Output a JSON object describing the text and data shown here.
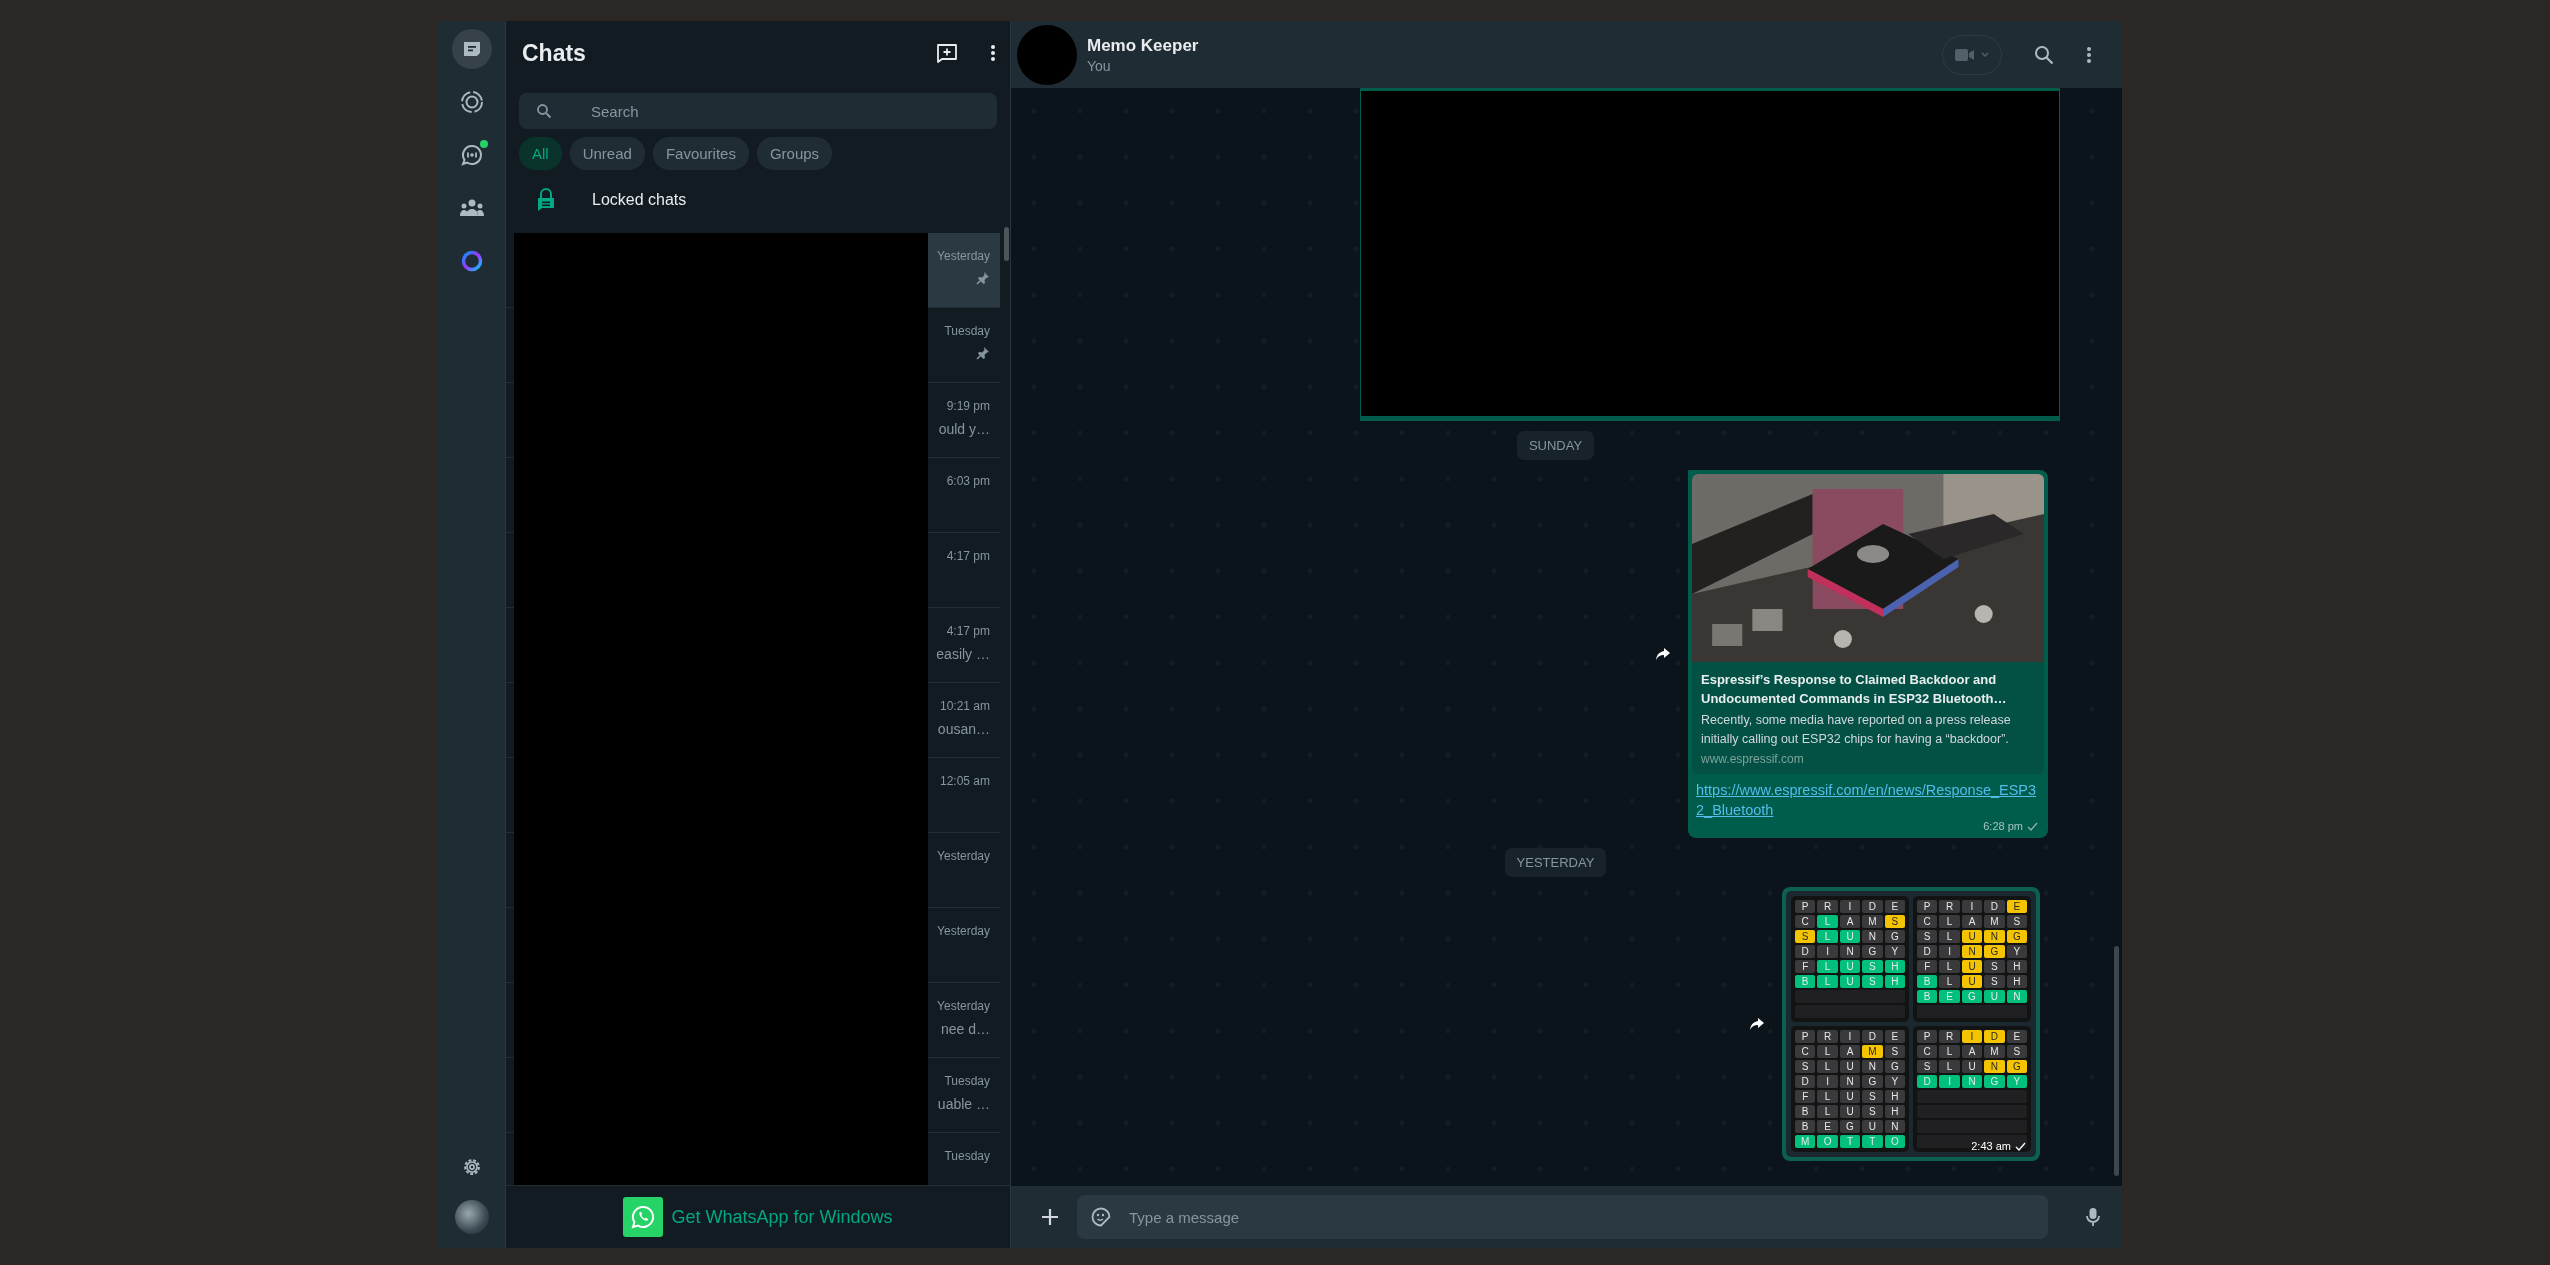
{
  "nav": {
    "top": [
      {
        "kind": "chats",
        "selected": true,
        "badge": false
      },
      {
        "kind": "status",
        "selected": false,
        "badge": false
      },
      {
        "kind": "channels",
        "selected": false,
        "badge": true
      },
      {
        "kind": "communities",
        "selected": false,
        "badge": false
      },
      {
        "kind": "meta_ai",
        "selected": false,
        "badge": false
      }
    ],
    "bottom": [
      {
        "kind": "settings"
      },
      {
        "kind": "profile"
      }
    ]
  },
  "chat_list": {
    "title": "Chats",
    "search": {
      "placeholder": "Search"
    },
    "filters": [
      {
        "label": "All",
        "selected": true
      },
      {
        "label": "Unread",
        "selected": false
      },
      {
        "label": "Favourites",
        "selected": false
      },
      {
        "label": "Groups",
        "selected": false
      }
    ],
    "locked": {
      "label": "Locked chats"
    },
    "rows": [
      {
        "time": "Yesterday",
        "pinned": true,
        "selected": true
      },
      {
        "time": "Tuesday",
        "pinned": true,
        "selected": false
      },
      {
        "time": "9:19 pm",
        "preview": "ould y…",
        "pinned": false,
        "selected": false
      },
      {
        "time": "6:03 pm",
        "pinned": false,
        "selected": false
      },
      {
        "time": "4:17 pm",
        "pinned": false,
        "selected": false
      },
      {
        "time": "4:17 pm",
        "preview": "easily …",
        "pinned": false,
        "selected": false
      },
      {
        "time": "10:21 am",
        "preview": "ousan…",
        "pinned": false,
        "selected": false
      },
      {
        "time": "12:05 am",
        "pinned": false,
        "selected": false
      },
      {
        "time": "Yesterday",
        "pinned": false,
        "selected": false
      },
      {
        "time": "Yesterday",
        "pinned": false,
        "selected": false
      },
      {
        "time": "Yesterday",
        "preview": "nee d…",
        "pinned": false,
        "selected": false
      },
      {
        "time": "Tuesday",
        "preview": "uable …",
        "pinned": false,
        "selected": false
      },
      {
        "time": "Tuesday",
        "pinned": false,
        "selected": false
      }
    ],
    "promo": {
      "label": "Get WhatsApp for Windows"
    }
  },
  "conversation": {
    "name": "Memo Keeper",
    "subtitle": "You",
    "messages": [
      {
        "kind": "redacted_media"
      },
      {
        "kind": "date",
        "label": "SUNDAY"
      },
      {
        "kind": "link",
        "forward": true,
        "title": "Espressif’s Response to Claimed Backdoor and Undocumented Commands in ESP32 Bluetooth…",
        "description": "Recently, some media have reported on a press release initially calling out ESP32 chips for having a “backdoor”.",
        "domain": "www.espressif.com",
        "url": "https://www.espressif.com/en/news/Response_ESP32_Bluetooth",
        "time": "6:28 pm",
        "sent": true
      },
      {
        "kind": "date",
        "label": "YESTERDAY"
      },
      {
        "kind": "wordle",
        "forward": true,
        "time": "2:43 am",
        "sent": true,
        "boards": [
          {
            "rows": [
              {
                "kind": "guess",
                "cells": [
                  {
                    "letter": "P",
                    "color": "#3a3a3c"
                  },
                  {
                    "letter": "R",
                    "color": "#3a3a3c"
                  },
                  {
                    "letter": "I",
                    "color": "#3a3a3c"
                  },
                  {
                    "letter": "D",
                    "color": "#3a3a3c"
                  },
                  {
                    "letter": "E",
                    "color": "#3a3a3c"
                  }
                ]
              },
              {
                "kind": "guess",
                "cells": [
                  {
                    "letter": "C",
                    "color": "#3a3a3c"
                  },
                  {
                    "letter": "L",
                    "color": "#00c07c"
                  },
                  {
                    "letter": "A",
                    "color": "#3a3a3c"
                  },
                  {
                    "letter": "M",
                    "color": "#3a3a3c"
                  },
                  {
                    "letter": "S",
                    "color": "#f5c400"
                  }
                ]
              },
              {
                "kind": "guess",
                "cells": [
                  {
                    "letter": "S",
                    "color": "#f5c400"
                  },
                  {
                    "letter": "L",
                    "color": "#00c07c"
                  },
                  {
                    "letter": "U",
                    "color": "#00c07c"
                  },
                  {
                    "letter": "N",
                    "color": "#3a3a3c"
                  },
                  {
                    "letter": "G",
                    "color": "#3a3a3c"
                  }
                ]
              },
              {
                "kind": "guess",
                "cells": [
                  {
                    "letter": "D",
                    "color": "#3a3a3c"
                  },
                  {
                    "letter": "I",
                    "color": "#3a3a3c"
                  },
                  {
                    "letter": "N",
                    "color": "#3a3a3c"
                  },
                  {
                    "letter": "G",
                    "color": "#3a3a3c"
                  },
                  {
                    "letter": "Y",
                    "color": "#3a3a3c"
                  }
                ]
              },
              {
                "kind": "guess",
                "cells": [
                  {
                    "letter": "F",
                    "color": "#3a3a3c"
                  },
                  {
                    "letter": "L",
                    "color": "#00c07c"
                  },
                  {
                    "letter": "U",
                    "color": "#00c07c"
                  },
                  {
                    "letter": "S",
                    "color": "#00c07c"
                  },
                  {
                    "letter": "H",
                    "color": "#00c07c"
                  }
                ]
              },
              {
                "kind": "guess",
                "cells": [
                  {
                    "letter": "B",
                    "color": "#00c07c"
                  },
                  {
                    "letter": "L",
                    "color": "#00c07c"
                  },
                  {
                    "letter": "U",
                    "color": "#00c07c"
                  },
                  {
                    "letter": "S",
                    "color": "#00c07c"
                  },
                  {
                    "letter": "H",
                    "color": "#00c07c"
                  }
                ]
              },
              {
                "kind": "blank"
              },
              {
                "kind": "blank"
              }
            ]
          },
          {
            "rows": [
              {
                "kind": "guess",
                "cells": [
                  {
                    "letter": "P",
                    "color": "#3a3a3c"
                  },
                  {
                    "letter": "R",
                    "color": "#3a3a3c"
                  },
                  {
                    "letter": "I",
                    "color": "#3a3a3c"
                  },
                  {
                    "letter": "D",
                    "color": "#3a3a3c"
                  },
                  {
                    "letter": "E",
                    "color": "#f5c400"
                  }
                ]
              },
              {
                "kind": "guess",
                "cells": [
                  {
                    "letter": "C",
                    "color": "#3a3a3c"
                  },
                  {
                    "letter": "L",
                    "color": "#3a3a3c"
                  },
                  {
                    "letter": "A",
                    "color": "#3a3a3c"
                  },
                  {
                    "letter": "M",
                    "color": "#3a3a3c"
                  },
                  {
                    "letter": "S",
                    "color": "#3a3a3c"
                  }
                ]
              },
              {
                "kind": "guess",
                "cells": [
                  {
                    "letter": "S",
                    "color": "#3a3a3c"
                  },
                  {
                    "letter": "L",
                    "color": "#3a3a3c"
                  },
                  {
                    "letter": "U",
                    "color": "#f5c400"
                  },
                  {
                    "letter": "N",
                    "color": "#f5c400"
                  },
                  {
                    "letter": "G",
                    "color": "#f5c400"
                  }
                ]
              },
              {
                "kind": "guess",
                "cells": [
                  {
                    "letter": "D",
                    "color": "#3a3a3c"
                  },
                  {
                    "letter": "I",
                    "color": "#3a3a3c"
                  },
                  {
                    "letter": "N",
                    "color": "#f5c400"
                  },
                  {
                    "letter": "G",
                    "color": "#f5c400"
                  },
                  {
                    "letter": "Y",
                    "color": "#3a3a3c"
                  }
                ]
              },
              {
                "kind": "guess",
                "cells": [
                  {
                    "letter": "F",
                    "color": "#3a3a3c"
                  },
                  {
                    "letter": "L",
                    "color": "#3a3a3c"
                  },
                  {
                    "letter": "U",
                    "color": "#f5c400"
                  },
                  {
                    "letter": "S",
                    "color": "#3a3a3c"
                  },
                  {
                    "letter": "H",
                    "color": "#3a3a3c"
                  }
                ]
              },
              {
                "kind": "guess",
                "cells": [
                  {
                    "letter": "B",
                    "color": "#00c07c"
                  },
                  {
                    "letter": "L",
                    "color": "#3a3a3c"
                  },
                  {
                    "letter": "U",
                    "color": "#f5c400"
                  },
                  {
                    "letter": "S",
                    "color": "#3a3a3c"
                  },
                  {
                    "letter": "H",
                    "color": "#3a3a3c"
                  }
                ]
              },
              {
                "kind": "guess",
                "cells": [
                  {
                    "letter": "B",
                    "color": "#00c07c"
                  },
                  {
                    "letter": "E",
                    "color": "#00c07c"
                  },
                  {
                    "letter": "G",
                    "color": "#00c07c"
                  },
                  {
                    "letter": "U",
                    "color": "#00c07c"
                  },
                  {
                    "letter": "N",
                    "color": "#00c07c"
                  }
                ]
              },
              {
                "kind": "blank"
              }
            ]
          },
          {
            "rows": [
              {
                "kind": "guess",
                "cells": [
                  {
                    "letter": "P",
                    "color": "#3a3a3c"
                  },
                  {
                    "letter": "R",
                    "color": "#3a3a3c"
                  },
                  {
                    "letter": "I",
                    "color": "#3a3a3c"
                  },
                  {
                    "letter": "D",
                    "color": "#3a3a3c"
                  },
                  {
                    "letter": "E",
                    "color": "#3a3a3c"
                  }
                ]
              },
              {
                "kind": "guess",
                "cells": [
                  {
                    "letter": "C",
                    "color": "#3a3a3c"
                  },
                  {
                    "letter": "L",
                    "color": "#3a3a3c"
                  },
                  {
                    "letter": "A",
                    "color": "#3a3a3c"
                  },
                  {
                    "letter": "M",
                    "color": "#f5c400"
                  },
                  {
                    "letter": "S",
                    "color": "#3a3a3c"
                  }
                ]
              },
              {
                "kind": "guess",
                "cells": [
                  {
                    "letter": "S",
                    "color": "#3a3a3c"
                  },
                  {
                    "letter": "L",
                    "color": "#3a3a3c"
                  },
                  {
                    "letter": "U",
                    "color": "#3a3a3c"
                  },
                  {
                    "letter": "N",
                    "color": "#3a3a3c"
                  },
                  {
                    "letter": "G",
                    "color": "#3a3a3c"
                  }
                ]
              },
              {
                "kind": "guess",
                "cells": [
                  {
                    "letter": "D",
                    "color": "#3a3a3c"
                  },
                  {
                    "letter": "I",
                    "color": "#3a3a3c"
                  },
                  {
                    "letter": "N",
                    "color": "#3a3a3c"
                  },
                  {
                    "letter": "G",
                    "color": "#3a3a3c"
                  },
                  {
                    "letter": "Y",
                    "color": "#3a3a3c"
                  }
                ]
              },
              {
                "kind": "guess",
                "cells": [
                  {
                    "letter": "F",
                    "color": "#3a3a3c"
                  },
                  {
                    "letter": "L",
                    "color": "#3a3a3c"
                  },
                  {
                    "letter": "U",
                    "color": "#3a3a3c"
                  },
                  {
                    "letter": "S",
                    "color": "#3a3a3c"
                  },
                  {
                    "letter": "H",
                    "color": "#3a3a3c"
                  }
                ]
              },
              {
                "kind": "guess",
                "cells": [
                  {
                    "letter": "B",
                    "color": "#3a3a3c"
                  },
                  {
                    "letter": "L",
                    "color": "#3a3a3c"
                  },
                  {
                    "letter": "U",
                    "color": "#3a3a3c"
                  },
                  {
                    "letter": "S",
                    "color": "#3a3a3c"
                  },
                  {
                    "letter": "H",
                    "color": "#3a3a3c"
                  }
                ]
              },
              {
                "kind": "guess",
                "cells": [
                  {
                    "letter": "B",
                    "color": "#3a3a3c"
                  },
                  {
                    "letter": "E",
                    "color": "#3a3a3c"
                  },
                  {
                    "letter": "G",
                    "color": "#3a3a3c"
                  },
                  {
                    "letter": "U",
                    "color": "#3a3a3c"
                  },
                  {
                    "letter": "N",
                    "color": "#3a3a3c"
                  }
                ]
              },
              {
                "kind": "guess",
                "cells": [
                  {
                    "letter": "M",
                    "color": "#00c07c"
                  },
                  {
                    "letter": "O",
                    "color": "#00c07c"
                  },
                  {
                    "letter": "T",
                    "color": "#00c07c"
                  },
                  {
                    "letter": "T",
                    "color": "#00c07c"
                  },
                  {
                    "letter": "O",
                    "color": "#00c07c"
                  }
                ]
              }
            ]
          },
          {
            "rows": [
              {
                "kind": "guess",
                "cells": [
                  {
                    "letter": "P",
                    "color": "#3a3a3c"
                  },
                  {
                    "letter": "R",
                    "color": "#3a3a3c"
                  },
                  {
                    "letter": "I",
                    "color": "#f5c400"
                  },
                  {
                    "letter": "D",
                    "color": "#f5c400"
                  },
                  {
                    "letter": "E",
                    "color": "#3a3a3c"
                  }
                ]
              },
              {
                "kind": "guess",
                "cells": [
                  {
                    "letter": "C",
                    "color": "#3a3a3c"
                  },
                  {
                    "letter": "L",
                    "color": "#3a3a3c"
                  },
                  {
                    "letter": "A",
                    "color": "#3a3a3c"
                  },
                  {
                    "letter": "M",
                    "color": "#3a3a3c"
                  },
                  {
                    "letter": "S",
                    "color": "#3a3a3c"
                  }
                ]
              },
              {
                "kind": "guess",
                "cells": [
                  {
                    "letter": "S",
                    "color": "#3a3a3c"
                  },
                  {
                    "letter": "L",
                    "color": "#3a3a3c"
                  },
                  {
                    "letter": "U",
                    "color": "#3a3a3c"
                  },
                  {
                    "letter": "N",
                    "color": "#f5c400"
                  },
                  {
                    "letter": "G",
                    "color": "#f5c400"
                  }
                ]
              },
              {
                "kind": "guess",
                "cells": [
                  {
                    "letter": "D",
                    "color": "#00c07c"
                  },
                  {
                    "letter": "I",
                    "color": "#00c07c"
                  },
                  {
                    "letter": "N",
                    "color": "#00c07c"
                  },
                  {
                    "letter": "G",
                    "color": "#00c07c"
                  },
                  {
                    "letter": "Y",
                    "color": "#00c07c"
                  }
                ]
              },
              {
                "kind": "blank"
              },
              {
                "kind": "blank"
              },
              {
                "kind": "blank"
              },
              {
                "kind": "blank"
              }
            ]
          }
        ]
      }
    ],
    "composer": {
      "placeholder": "Type a message"
    }
  }
}
